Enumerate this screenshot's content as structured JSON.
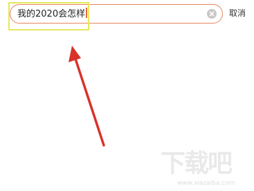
{
  "search": {
    "value": "我的2020会怎样"
  },
  "header": {
    "cancel_label": "取消"
  },
  "watermark": {
    "logo_text": "下载吧",
    "url_text": "www.xiazaiba.com"
  },
  "icons": {
    "clear": "clear-circle-icon",
    "annotation": "red-arrow-icon"
  },
  "colors": {
    "search_border": "#e8845a",
    "highlight": "#e6e85a",
    "arrow": "#d8322a",
    "caret": "#e06a3a"
  }
}
